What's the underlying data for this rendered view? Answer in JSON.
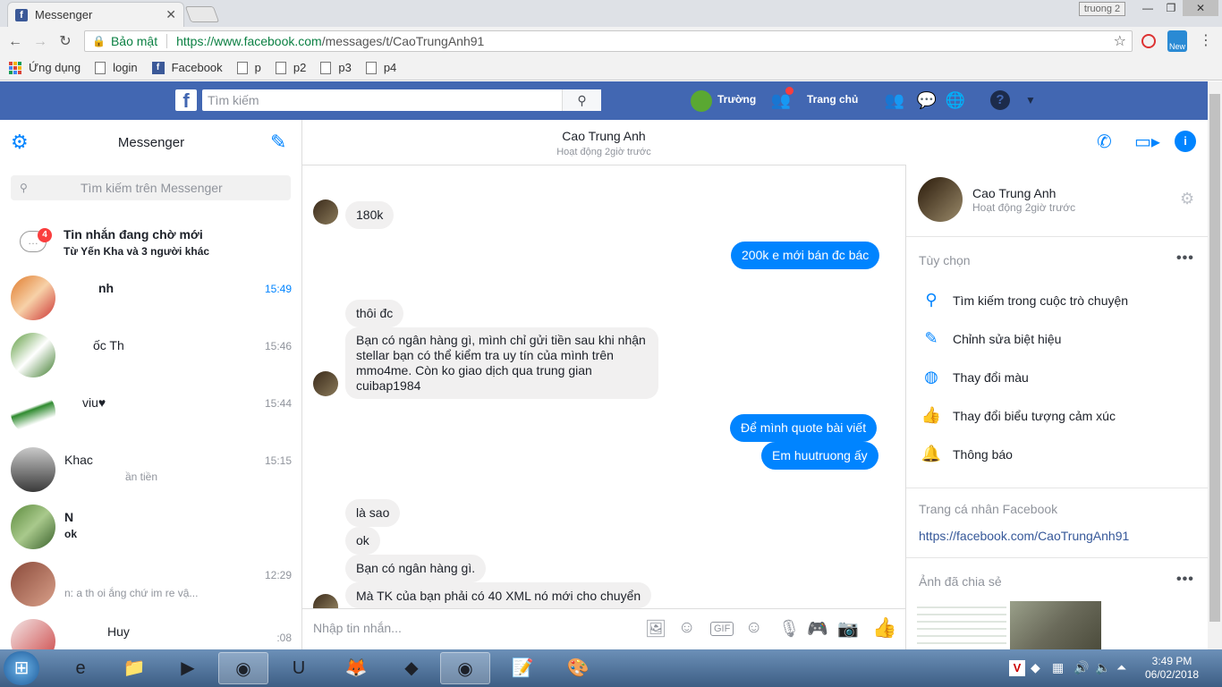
{
  "browser": {
    "tab_title": "Messenger",
    "profile": "truong 2",
    "secure_label": "Bảo mật",
    "url_host": "https://www.facebook.com",
    "url_path": "/messages/t/CaoTrungAnh91",
    "badge_new": "New",
    "bookmarks": [
      "Ứng dụng",
      "login",
      "Facebook",
      "p",
      "p2",
      "p3",
      "p4"
    ]
  },
  "fb_header": {
    "search_placeholder": "Tìm kiếm",
    "user": "Trường",
    "home": "Trang chủ",
    "logo": "f"
  },
  "left": {
    "title": "Messenger",
    "search_placeholder": "Tìm kiếm trên Messenger",
    "pending_title": "Tin nhắn đang chờ mới",
    "pending_sub": "Từ Yến Kha và 3 người khác",
    "pending_count": "4",
    "conversations": [
      {
        "name": "nh",
        "preview": "",
        "time": "15:49"
      },
      {
        "name": "ốc Th",
        "preview": "",
        "time": "15:46"
      },
      {
        "name": "viu♥",
        "preview": "",
        "time": "15:44"
      },
      {
        "name": "Khac",
        "preview": "ần tiền",
        "time": "15:15"
      },
      {
        "name": "N",
        "preview": "ok",
        "time": ""
      },
      {
        "name": "",
        "preview": "n: a th   oi  ắng chứ im re vậ...",
        "time": "12:29"
      },
      {
        "name": "Huy",
        "preview": "",
        "time": ":08"
      }
    ]
  },
  "chat": {
    "contact": "Cao Trung Anh",
    "status": "Hoạt động 2giờ trước",
    "composer_placeholder": "Nhập tin nhắn...",
    "gif_label": "GIF",
    "messages": [
      {
        "dir": "in",
        "text": "180k"
      },
      {
        "dir": "out",
        "text": "200k e mới bán đc bác"
      },
      {
        "dir": "in",
        "text": "thôi đc"
      },
      {
        "dir": "in",
        "text": "Bạn có ngân hàng gì, mình chỉ gửi tiền sau khi nhận stellar bạn có thể kiểm tra uy tín của mình trên mmo4me. Còn ko giao dịch qua trung gian cuibap1984"
      },
      {
        "dir": "out",
        "text": "Để mình quote bài viết"
      },
      {
        "dir": "out",
        "text": "Em huutruong ấy"
      },
      {
        "dir": "in",
        "text": "là sao"
      },
      {
        "dir": "in",
        "text": "ok"
      },
      {
        "dir": "in",
        "text": "Bạn có ngân hàng gì."
      },
      {
        "dir": "in",
        "text": "Mà TK của bạn phải có 40 XML nó mới cho chuyển"
      }
    ]
  },
  "right": {
    "name": "Cao Trung Anh",
    "status": "Hoạt động 2giờ trước",
    "options_title": "Tùy chọn",
    "options": [
      "Tìm kiếm trong cuộc trò chuyện",
      "Chỉnh sửa biệt hiệu",
      "Thay đổi màu",
      "Thay đổi biểu tượng cảm xúc",
      "Thông báo"
    ],
    "profile_title": "Trang cá nhân Facebook",
    "profile_link": "https://facebook.com/CaoTrungAnh91",
    "shared_title": "Ảnh đã chia sẻ"
  },
  "taskbar": {
    "time": "3:49 PM",
    "date": "06/02/2018"
  },
  "colors": {
    "fb_blue": "#4267b2",
    "messenger_blue": "#0084ff",
    "bubble_gray": "#f1f0f0"
  }
}
